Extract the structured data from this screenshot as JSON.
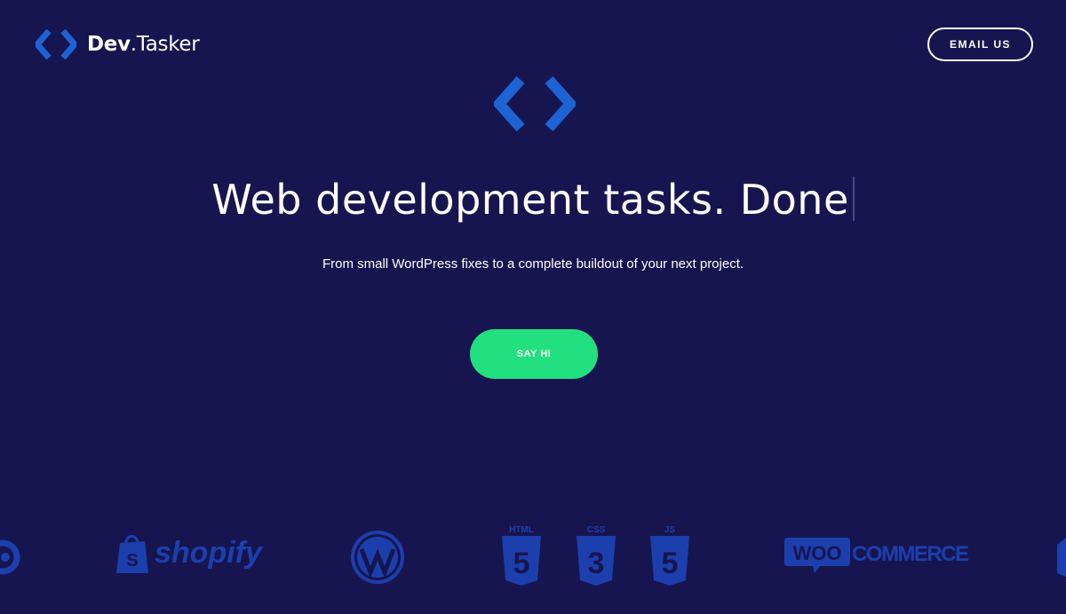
{
  "header": {
    "brand_bold": "Dev",
    "brand_rest": ".Tasker",
    "email_label": "EMAIL US"
  },
  "hero": {
    "headline": "Web development tasks. Done",
    "subtitle": "From small WordPress fixes to a complete buildout of your next project.",
    "cta_label": "SAY HI"
  },
  "logos": {
    "shopify": "shopify",
    "html5_label": "HTML",
    "html5_num": "5",
    "css3_label": "CSS",
    "css3_num": "3",
    "js_label": "JS",
    "js_num": "5",
    "woo_a": "WOO",
    "woo_b": "COMMERCE"
  },
  "colors": {
    "background": "#17154f",
    "accent_blue": "#1d63d6",
    "cta_green": "#22e07f",
    "logo_muted": "#1c3fae"
  },
  "icons": [
    "code-brackets-icon",
    "shopify-bag-icon",
    "wordpress-icon",
    "html5-shield-icon",
    "css3-shield-icon",
    "js-shield-icon",
    "woocommerce-icon"
  ]
}
